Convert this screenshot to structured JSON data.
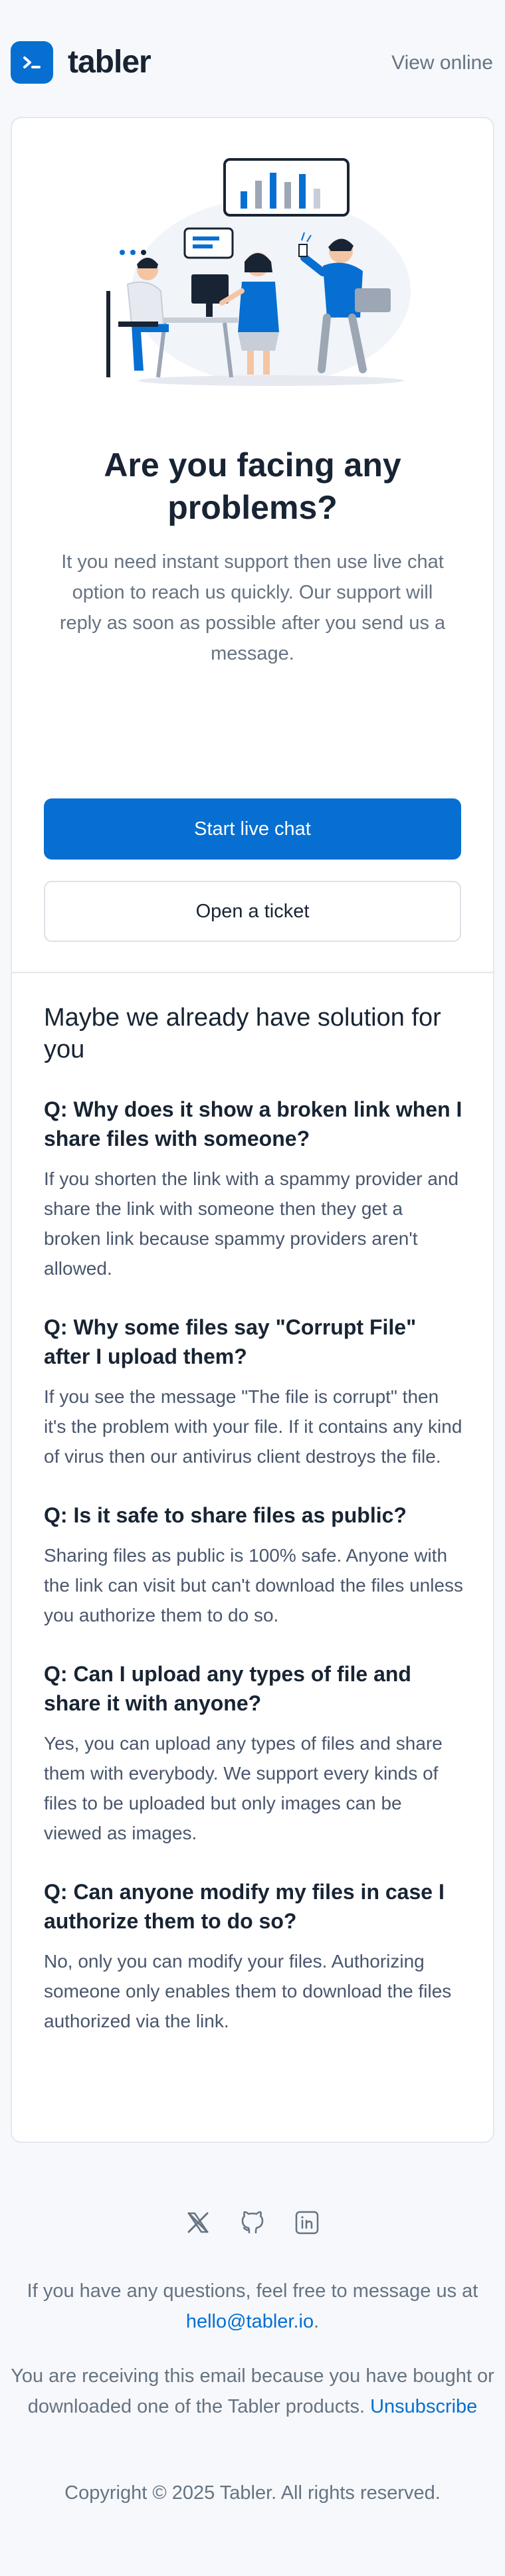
{
  "header": {
    "logo_text": "tabler",
    "view_online": "View online"
  },
  "hero": {
    "title": "Are you facing any problems?",
    "lead": "It you need instant support then use live chat option to reach us quickly. Our support will reply as soon as possible after you send us a message.",
    "primary_button": "Start live chat",
    "secondary_button": "Open a ticket"
  },
  "faq": {
    "heading": "Maybe we already have solution for you",
    "items": [
      {
        "question": "Q: Why does it show a broken link when I share files with someone?",
        "answer": "If you shorten the link with a spammy provider and share the link with someone then they get a broken link because spammy providers aren't allowed."
      },
      {
        "question": "Q: Why some files say \"Corrupt File\" after I upload them?",
        "answer": "If you see the message \"The file is corrupt\" then it's the problem with your file. If it contains any kind of virus then our antivirus client destroys the file."
      },
      {
        "question": "Q: Is it safe to share files as public?",
        "answer": "Sharing files as public is 100% safe. Anyone with the link can visit but can't download the files unless you authorize them to do so."
      },
      {
        "question": "Q: Can I upload any types of file and share it with anyone?",
        "answer": "Yes, you can upload any types of files and share them with everybody. We support every kinds of files to be uploaded but only images can be viewed as images."
      },
      {
        "question": "Q: Can anyone modify my files in case I authorize them to do so?",
        "answer": "No, only you can modify your files. Authorizing someone only enables them to download the files authorized via the link."
      }
    ]
  },
  "footer": {
    "social_icons": [
      "x-icon",
      "github-icon",
      "linkedin-icon"
    ],
    "questions_text": "If you have any questions, feel free to message us at",
    "email": "hello@tabler.io",
    "email_suffix": ".",
    "receiving_text": "You are receiving this email because you have bought or downloaded one of the Tabler products.",
    "unsubscribe": "Unsubscribe",
    "copyright": "Copyright © 2025 Tabler. All rights reserved."
  },
  "colors": {
    "brand": "#066fd1",
    "background": "#f6f8fb",
    "text": "#182433",
    "muted": "#667382"
  }
}
